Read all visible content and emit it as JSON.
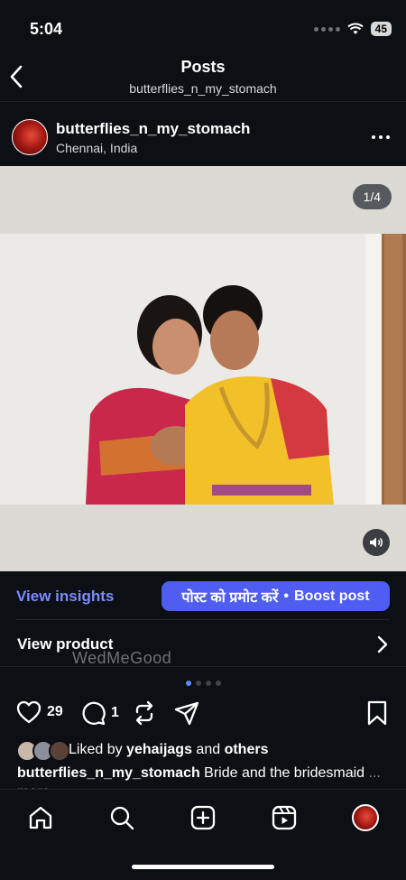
{
  "status": {
    "time": "5:04",
    "battery": "45"
  },
  "header": {
    "title": "Posts",
    "subtitle": "butterflies_n_my_stomach"
  },
  "post": {
    "username": "butterflies_n_my_stomach",
    "location": "Chennai, India",
    "counter": "1/4",
    "watermark": "WedMeGood"
  },
  "promo": {
    "insights": "View insights",
    "boost_hindi": "पोस्ट को प्रमोट करें",
    "boost_sep": "•",
    "boost_en": "Boost post",
    "view_product": "View product"
  },
  "actions": {
    "likes": "29",
    "comments": "1"
  },
  "liked": {
    "prefix": "Liked by ",
    "user": "yehaijags",
    "mid": " and ",
    "others": "others"
  },
  "caption": {
    "user": "butterflies_n_my_stomach",
    "text": " Bride and the bridesmaid",
    "more": "... more"
  },
  "carousel": {
    "total": 4,
    "active": 1
  },
  "colors": {
    "accent": "#4f5df0",
    "link": "#7d8cff",
    "background": "#0c0f14"
  }
}
